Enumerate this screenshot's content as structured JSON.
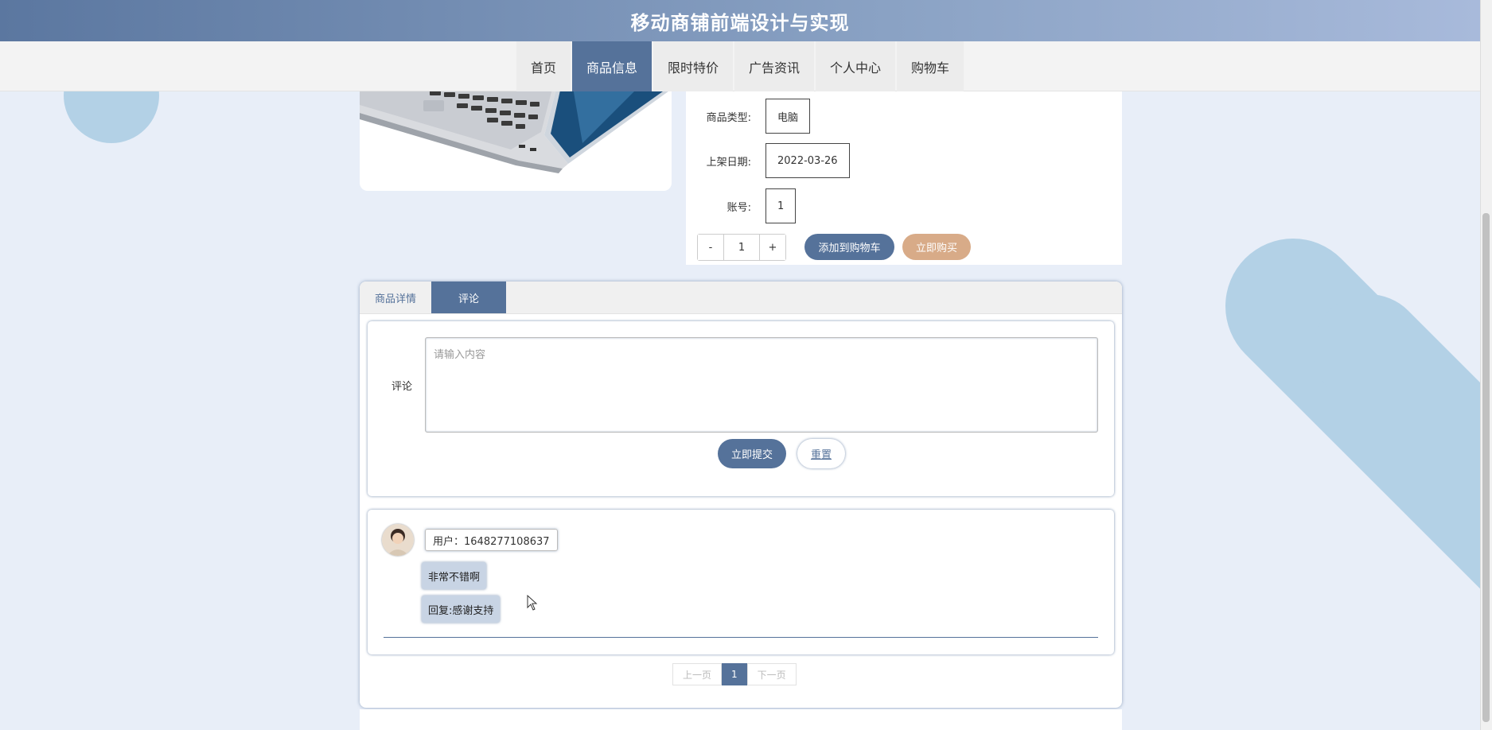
{
  "header": {
    "site_title": "移动商铺前端设计与实现"
  },
  "nav": {
    "items": [
      {
        "label": "首页",
        "active": false
      },
      {
        "label": "商品信息",
        "active": true
      },
      {
        "label": "限时特价",
        "active": false
      },
      {
        "label": "广告资讯",
        "active": false
      },
      {
        "label": "个人中心",
        "active": false
      },
      {
        "label": "购物车",
        "active": false
      }
    ]
  },
  "product": {
    "fields": [
      {
        "label": "商品类型:",
        "value": "电脑"
      },
      {
        "label": "上架日期:",
        "value": "2022-03-26"
      },
      {
        "label": "账号:",
        "value": "1"
      }
    ],
    "quantity": {
      "minus": "-",
      "value": "1",
      "plus": "+"
    },
    "add_to_cart_label": "添加到购物车",
    "buy_now_label": "立即购买"
  },
  "tabs": [
    {
      "label": "商品详情",
      "active": false
    },
    {
      "label": "评论",
      "active": true
    }
  ],
  "comment_form": {
    "label": "评论",
    "placeholder": "请输入内容",
    "submit_label": "立即提交",
    "reset_label": "重置"
  },
  "comments": [
    {
      "user": "用户：1648277108637",
      "content": "非常不错啊",
      "reply": "回复:感谢支持"
    }
  ],
  "pager": {
    "prev_label": "上一页",
    "current": "1",
    "next_label": "下一页"
  },
  "colors": {
    "primary": "#55729a",
    "buy": "#d8ab88",
    "background": "#e8eef8",
    "deco": "#b3d1e6"
  }
}
